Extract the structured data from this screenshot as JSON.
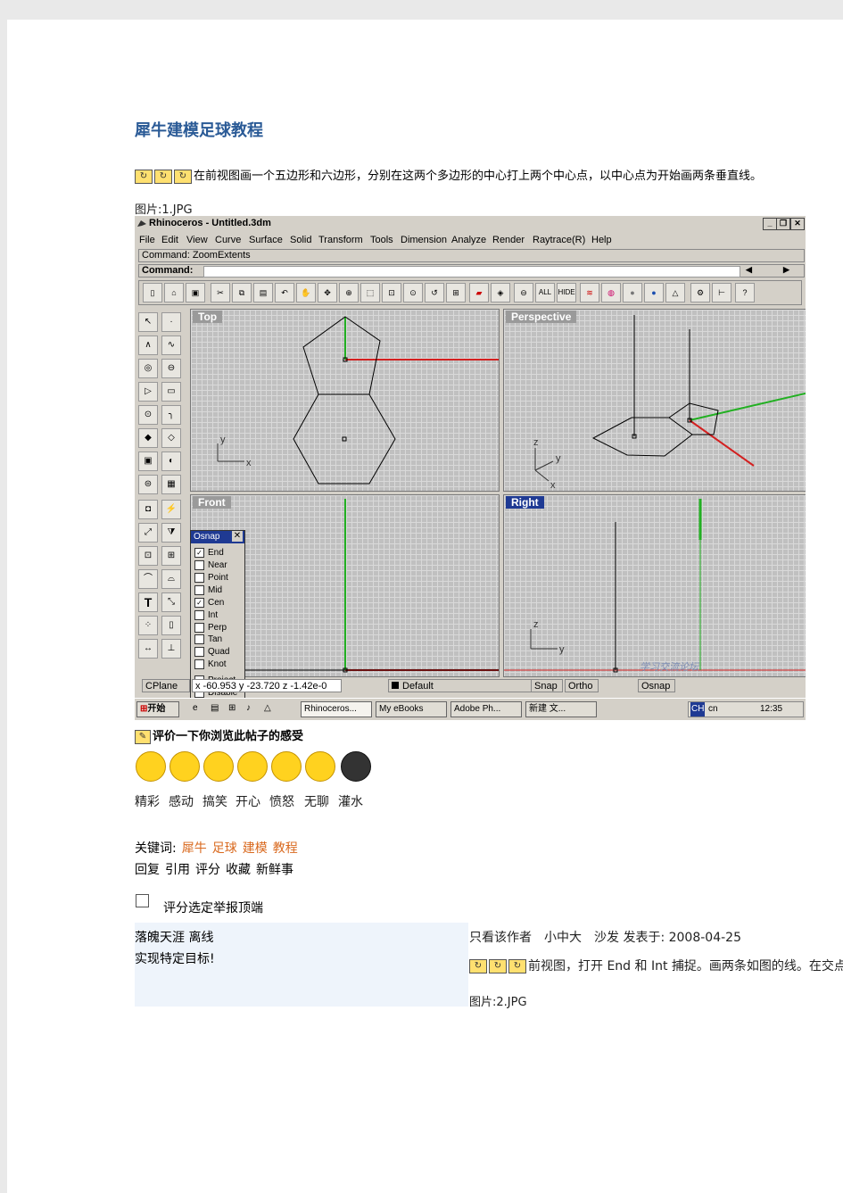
{
  "article": {
    "title": "犀牛建模足球教程",
    "intro": "在前视图画一个五边形和六边形，分别在这两个多边形的中心打上两个中心点，以中心点为开始画两条垂直线。",
    "caption1": "图片:1.JPG"
  },
  "rhino": {
    "window_title": "Rhinoceros - Untitled.3dm",
    "menu": [
      "File",
      "Edit",
      "View",
      "Curve",
      "Surface",
      "Solid",
      "Transform",
      "Tools",
      "Dimension",
      "Analyze",
      "Render",
      "Raytrace(R)",
      "Help"
    ],
    "command_history": "Command: ZoomExtents",
    "command_prompt": "Command:",
    "toolbar_all": "ALL",
    "toolbar_hide": "HIDE",
    "viewports": {
      "top": "Top",
      "perspective": "Perspective",
      "front": "Front",
      "right": "Right"
    },
    "axes": {
      "x": "x",
      "y": "y",
      "z": "z"
    },
    "osnap": {
      "title": "Osnap",
      "items": [
        {
          "label": "End",
          "checked": true
        },
        {
          "label": "Near",
          "checked": false
        },
        {
          "label": "Point",
          "checked": false
        },
        {
          "label": "Mid",
          "checked": false
        },
        {
          "label": "Cen",
          "checked": true
        },
        {
          "label": "Int",
          "checked": false
        },
        {
          "label": "Perp",
          "checked": false
        },
        {
          "label": "Tan",
          "checked": false
        },
        {
          "label": "Quad",
          "checked": false
        },
        {
          "label": "Knot",
          "checked": false
        },
        {
          "label": "Project",
          "checked": false
        },
        {
          "label": "Disable",
          "checked": false
        }
      ]
    },
    "status": {
      "cplane": "CPlane",
      "coords": "x -60.953 y -23.720 z -1.42e-0",
      "layer": "Default",
      "snap": "Snap",
      "ortho": "Ortho",
      "osnap": "Osnap"
    },
    "taskbar": {
      "start": "开始",
      "tasks": [
        "Rhinoceros...",
        "My eBooks",
        "Adobe Ph...",
        "新建 文..."
      ],
      "lang": "CH",
      "ime": "cn",
      "clock": "12:35"
    },
    "watermark": "学习交流论坛"
  },
  "rating": {
    "prompt": "评价一下你浏览此帖子的感受",
    "labels": [
      "精彩",
      "感动",
      "搞笑",
      "开心",
      "愤怒",
      "无聊",
      "灌水"
    ]
  },
  "keywords": {
    "label": "关键词:",
    "items": [
      "犀牛",
      "足球",
      "建模",
      "教程"
    ]
  },
  "actions": [
    "回复",
    "引用",
    "评分",
    "收藏",
    "新鲜事"
  ],
  "report": "评分选定举报顶端",
  "post": {
    "user": "落魄天涯 离线",
    "signature": "实现特定目标!",
    "meta": "只看该作者　小中大　沙发  发表于:  2008-04-25",
    "step": "前视图，打开 End 和 Int 捕捉。画两条如图的线。在交点",
    "caption": "图片:2.JPG"
  }
}
